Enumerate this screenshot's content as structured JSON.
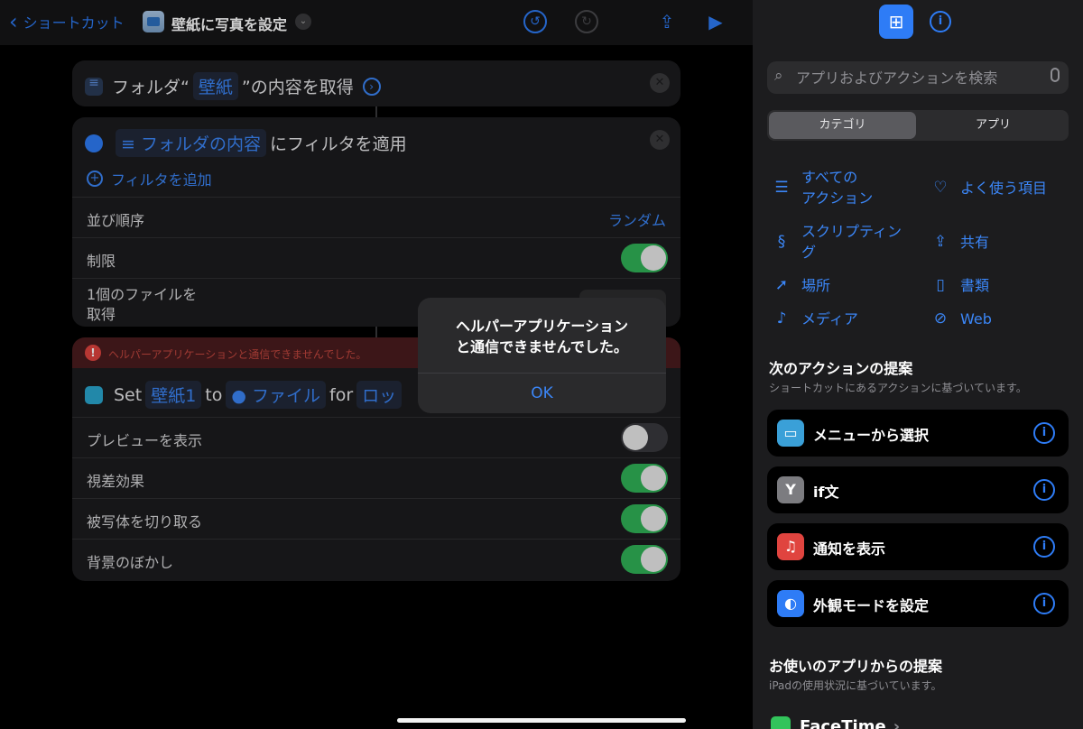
{
  "topbar": {
    "back_label": "ショートカット",
    "title": "壁紙に写真を設定"
  },
  "action_get_folder": {
    "prefix": "フォルダ“",
    "folder_token": "壁紙",
    "suffix": "”の内容を取得"
  },
  "action_filter": {
    "input_token": "フォルダの内容",
    "text": "にフィルタを適用",
    "add_filter": "フィルタを追加",
    "sort_label": "並び順序",
    "sort_value": "ランダム",
    "limit_label": "制限",
    "limit_on": true,
    "get_label_line1": "1個のファイルを",
    "get_label_line2": "取得"
  },
  "action_set_wallpaper": {
    "error_text": "ヘルパーアプリケーションと通信できませんでした。",
    "set_word": "Set",
    "wallpaper_token": "壁紙1",
    "to_word": "to",
    "file_token": "ファイル",
    "for_word": "for",
    "lock_token": "ロッ",
    "options": [
      {
        "label": "プレビューを表示",
        "on": false
      },
      {
        "label": "視差効果",
        "on": true
      },
      {
        "label": "被写体を切り取る",
        "on": true
      },
      {
        "label": "背景のぼかし",
        "on": true
      }
    ]
  },
  "alert": {
    "message_line1": "ヘルパーアプリケーション",
    "message_line2": "と通信できませんでした。",
    "ok_label": "OK"
  },
  "library": {
    "search_placeholder": "アプリおよびアクションを検索",
    "segment_categories": "カテゴリ",
    "segment_apps": "アプリ",
    "categories": {
      "all_actions_line1": "すべての",
      "all_actions_line2": "アクション",
      "favorites": "よく使う項目",
      "scripting_line1": "スクリプティン",
      "scripting_line2": "グ",
      "share": "共有",
      "location": "場所",
      "documents": "書類",
      "media": "メディア",
      "web": "Web"
    },
    "next_actions_title": "次のアクションの提案",
    "next_actions_sub": "ショートカットにあるアクションに基づいています。",
    "suggestions": [
      {
        "label": "メニューから選択",
        "icon": "menu-icon",
        "color": "#3aa0d8"
      },
      {
        "label": "if文",
        "icon": "branch-icon",
        "color": "#7c7c80"
      },
      {
        "label": "通知を表示",
        "icon": "bell-icon",
        "color": "#e0443f"
      },
      {
        "label": "外観モードを設定",
        "icon": "appearance-icon",
        "color": "#2e7cf6"
      }
    ],
    "apps_title": "お使いのアプリからの提案",
    "apps_sub": "iPadの使用状況に基づいています。",
    "facetime_label": "FaceTime"
  },
  "colors": {
    "accent": "#2e7cf6",
    "toggle_on": "#30b357",
    "error": "#e0443f"
  }
}
